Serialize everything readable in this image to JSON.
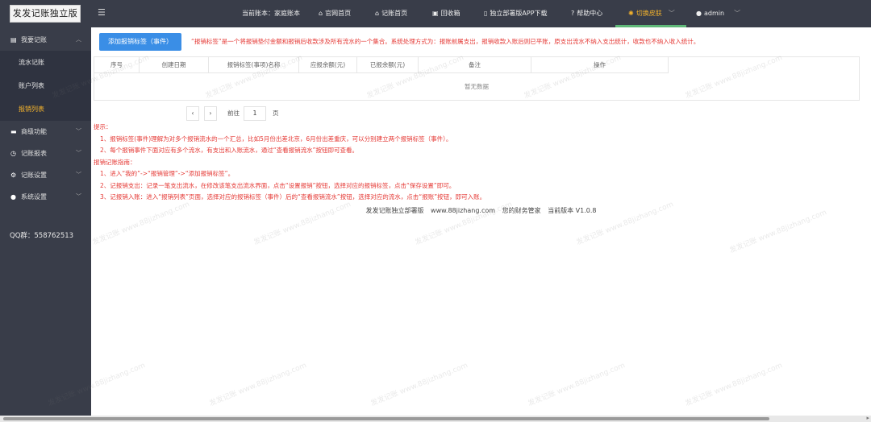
{
  "app": {
    "logo": "发发记账独立版"
  },
  "sidebar": {
    "items": [
      {
        "label": "我要记账",
        "icon": "ledger-icon",
        "expanded": true,
        "children": [
          {
            "label": "流水记账",
            "active": false
          },
          {
            "label": "账户列表",
            "active": false
          },
          {
            "label": "报销列表",
            "active": true
          }
        ]
      },
      {
        "label": "商级功能",
        "icon": "briefcase-icon"
      },
      {
        "label": "记账报表",
        "icon": "clock-icon"
      },
      {
        "label": "记账设置",
        "icon": "gear-icon"
      },
      {
        "label": "系统设置",
        "icon": "user-icon"
      }
    ],
    "qq": "QQ群：558762513"
  },
  "topbar": {
    "book": "当前账本：家庭账本",
    "home": "官网首页",
    "ledger_home": "记账首页",
    "recycle": "回收箱",
    "app_download": "独立部署版APP下载",
    "help": "帮助中心",
    "theme": "切换皮肤",
    "user": "admin"
  },
  "main": {
    "add_button": "添加报销标签（事件）",
    "tip_top": "“报销标签”是一个将报销垫付金额和报销后收款涉及所有流水的一个集合。系统处理方式为：报账前属支出，报销收款入账后则已平账，原支出流水不纳入支出统计，收款也不纳入收入统计。",
    "table": {
      "columns": [
        "序号",
        "创建日期",
        "报销标签(事项)名称",
        "应报余额(元)",
        "已报余额(元)",
        "备注",
        "操作"
      ],
      "empty": "暂无数据"
    },
    "pager": {
      "prev": "‹",
      "next": "›",
      "goto": "前往",
      "page": "1",
      "unit": "页"
    },
    "notes": [
      "提示：",
      "1、报销标签(事件)理解为对多个报销流水的一个汇总，比如5月份出差北京，6月份出差重庆，可以分别建立两个报销标签（事件）。",
      "2、每个报销事件下面对应有多个流水，有支出和入账流水，通过“查看报销流水”按钮即可查看。",
      "报销记账指南：",
      "1、进入“我的”->“报销管理”->“添加报销标签”。",
      "2、记报销支出：记录一笔支出流水，在修改该笔支出流水界面，点击“设置报销”按钮，选择对应的报销标签，点击“保存设置”即可。",
      "3、记报销入账：进入“报销列表”页面，选择对应的报销标签（事件）后的“查看报销流水”按钮，选择对应的流水，点击“报账”按钮，即可入账。"
    ],
    "footer": {
      "name": "发发记账独立部署版",
      "site": "www.88jizhang.com",
      "slogan": "您的财务管家",
      "version": "当前版本 V1.0.8"
    }
  },
  "watermark": "发发记账 www.88jizhang.com"
}
